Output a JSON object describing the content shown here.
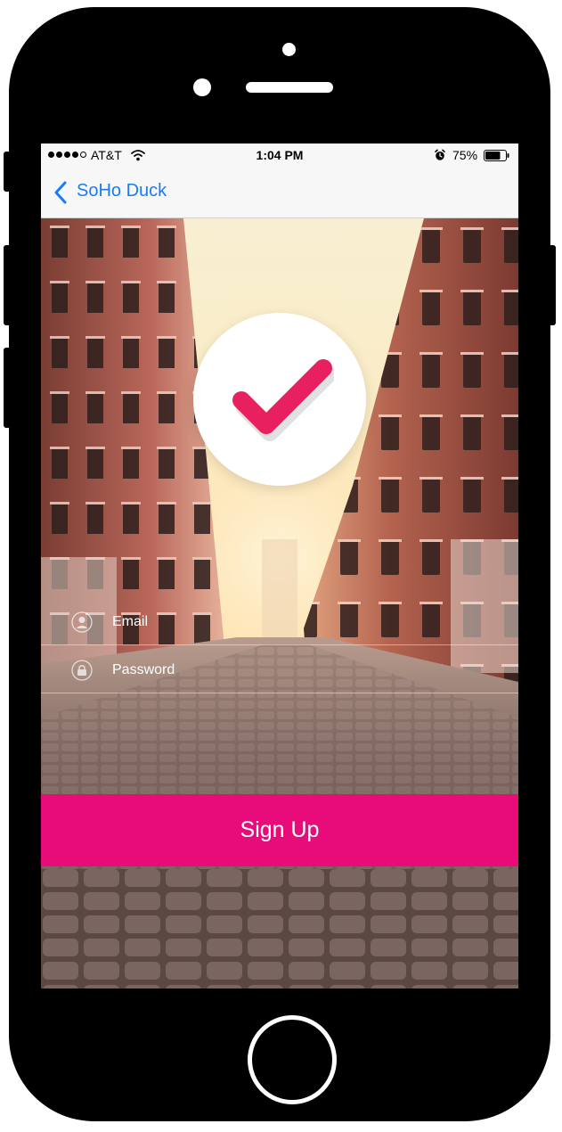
{
  "status_bar": {
    "carrier": "AT&T",
    "time": "1:04 PM",
    "battery_percent": "75%",
    "signal_bars_filled": 4,
    "signal_bars_total": 5,
    "battery_level": 0.75
  },
  "nav": {
    "back_label": "SoHo Duck"
  },
  "form": {
    "email_placeholder": "Email",
    "password_placeholder": "Password"
  },
  "actions": {
    "signup_label": "Sign Up"
  },
  "colors": {
    "accent": "#e80c7a",
    "check": "#e8205f",
    "link": "#1a7cf5"
  },
  "icons": [
    "wifi-icon",
    "alarm-icon",
    "battery-icon",
    "chevron-left-icon",
    "checkmark-icon",
    "user-icon",
    "lock-icon"
  ]
}
